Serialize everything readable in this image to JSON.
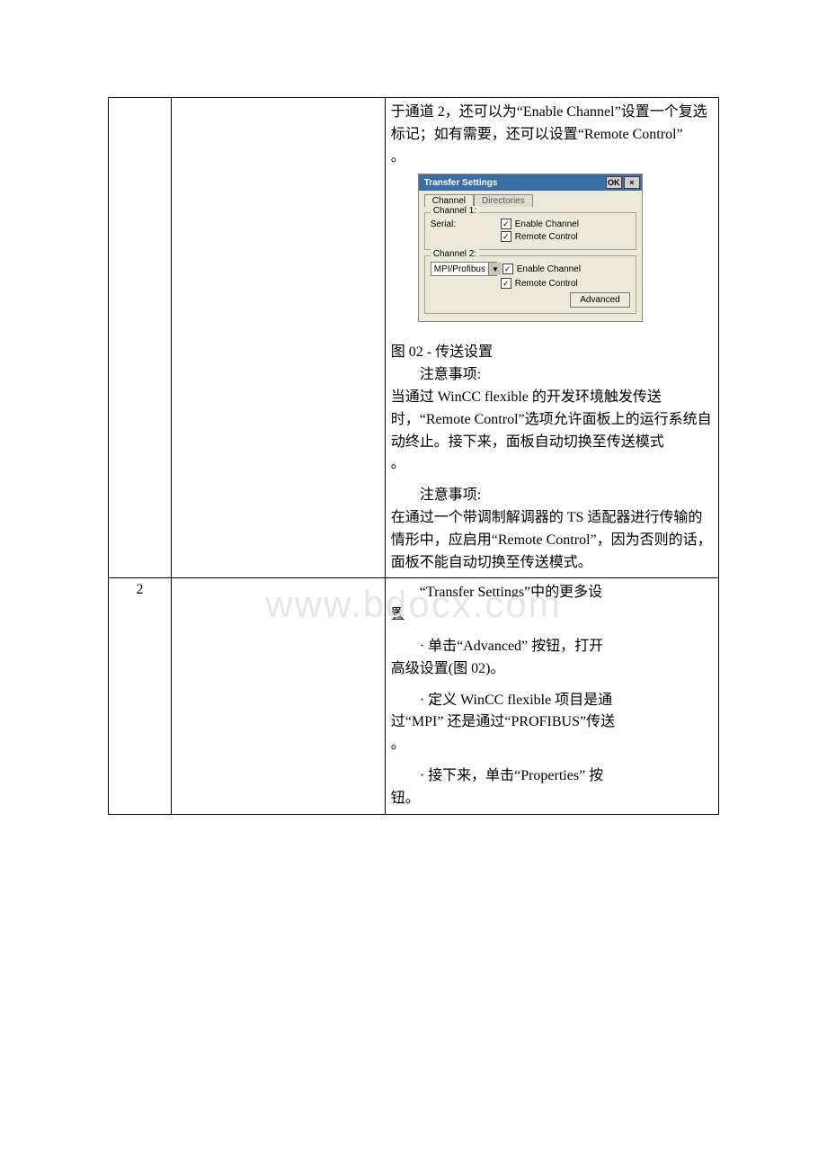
{
  "watermark": "www.bdocx.com",
  "row1": {
    "para1_a": "于通道 2，还可以为“",
    "para1_b": "Enable Channel",
    "para1_c": "”设置一个复选标记；如有需要，还可以设置“",
    "para1_d": "Remote Control",
    "para1_e": "”",
    "para1_f": "。",
    "dialog": {
      "title": "Transfer Settings",
      "btn_ok": "OK",
      "btn_x": "×",
      "tab_channel": "Channel",
      "tab_directories": "Directories",
      "grp1": "Channel 1:",
      "serial": "Serial:",
      "enable": "Enable Channel",
      "remote1": "Remote Control",
      "grp2": "Channel 2:",
      "profibus": "MPI/Profibus",
      "enable2": "Enable Channel",
      "remote2": "Remote Control",
      "advanced": "Advanced"
    },
    "fig_caption": "图 02 - 传送设置",
    "note1_h": "注意事项:",
    "para2_a": "当通过 WinCC flexible 的开发环境触发传送时，“",
    "para2_b": "Remote Control",
    "para2_c": "”选项允许面板上的运行系统自动终止。接下来，面板自动切换至传送模式",
    "para2_d": "。",
    "note2_h": "注意事项:",
    "para3_a": "在通过一个带调制解调器的 TS 适配器进行传输的情形中，应启用“",
    "para3_b": "Remote Control",
    "para3_c": "”，因为否则的话，面板不能自动切换至传送模式。"
  },
  "row2": {
    "num": "2",
    "p1_a": "“",
    "p1_b": "Transfer Settings",
    "p1_c": "”中的更多设",
    "p1_d": "置",
    "p2_a": "· 单击“",
    "p2_b": "Advanced",
    "p2_c": "” 按钮，打开",
    "p2_d": "高级设置(图 02)。",
    "p3_a": "· 定义 WinCC flexible 项目是通",
    "p3_b": "过“",
    "p3_c": "MPI",
    "p3_d": "” 还是通过“",
    "p3_e": "PROFIBUS",
    "p3_f": "”传送",
    "p3_g": "。",
    "p4_a": "· 接下来，单击“",
    "p4_b": "Properties",
    "p4_c": "” 按",
    "p4_d": "钮。"
  }
}
